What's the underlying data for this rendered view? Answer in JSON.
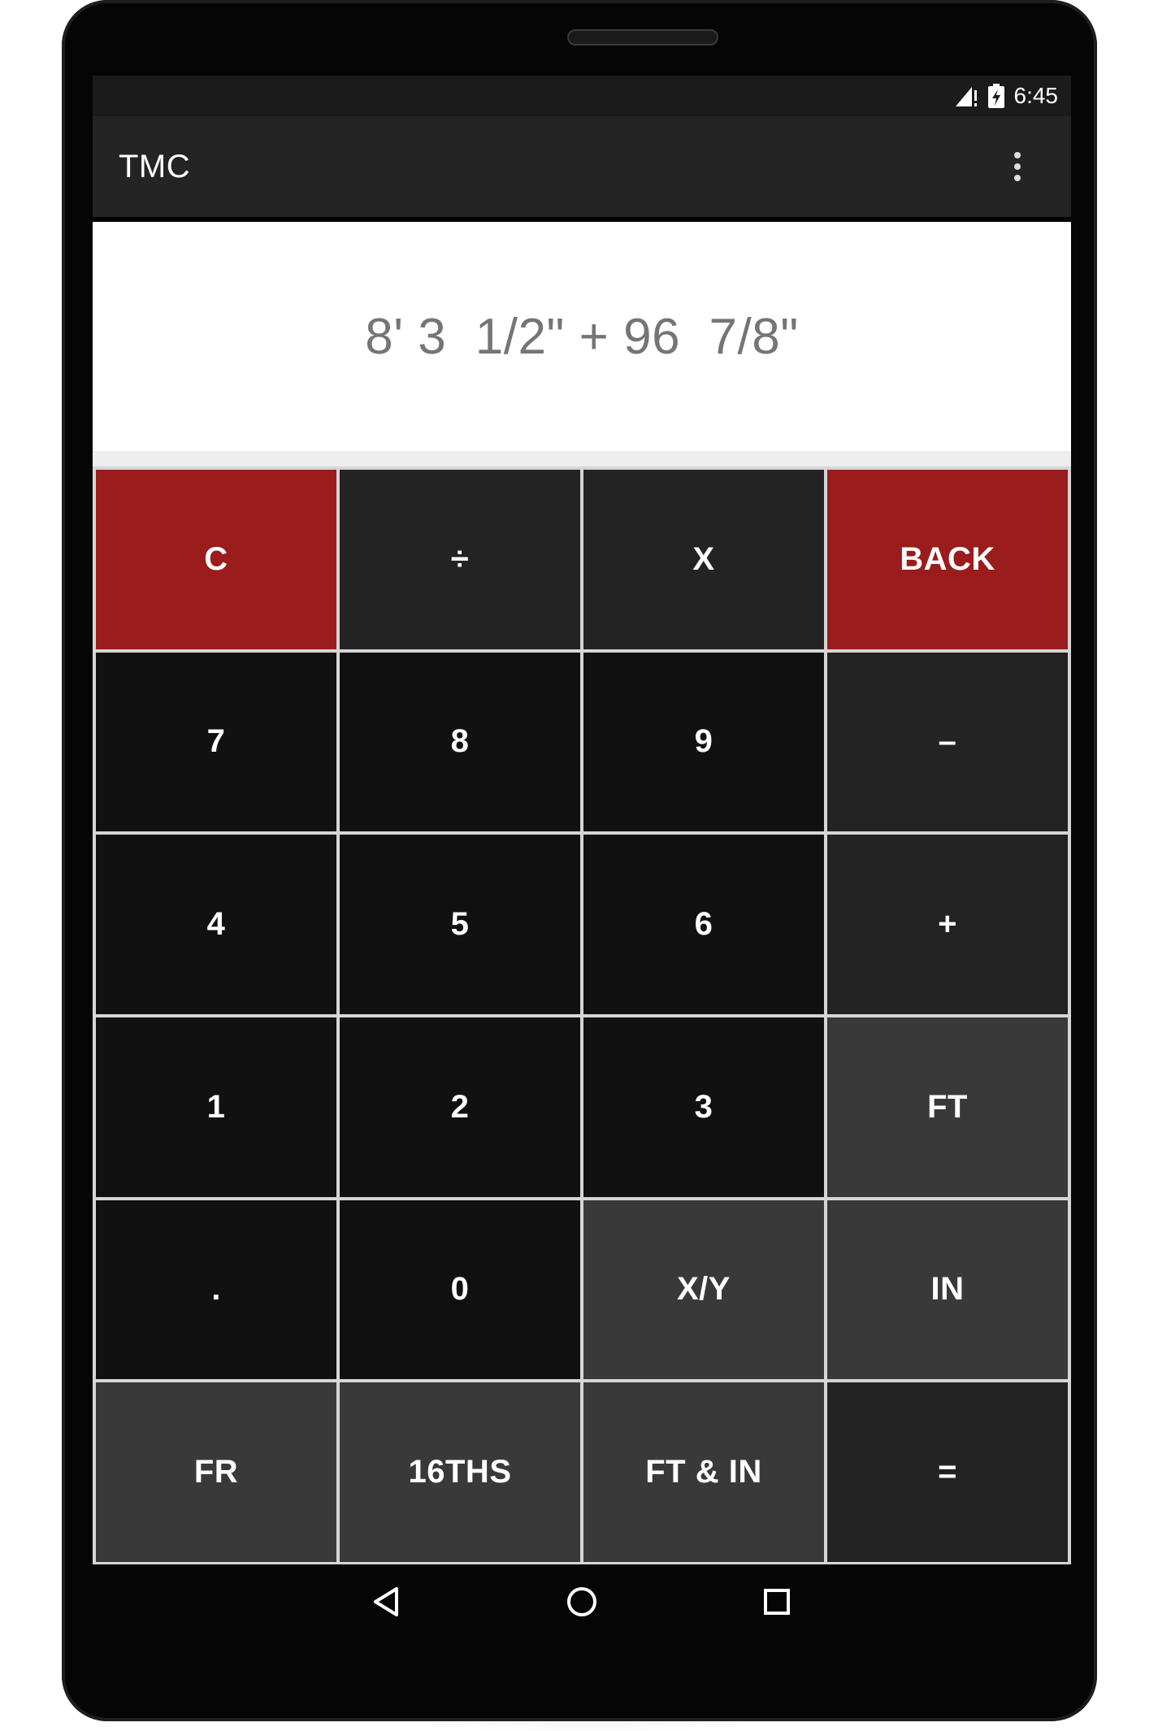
{
  "status_bar": {
    "time": "6:45",
    "signal_icon": "signal-icon",
    "battery_icon": "battery-charging-icon"
  },
  "toolbar": {
    "title": "TMC",
    "overflow_icon": "more-vert-icon"
  },
  "display": {
    "expression": "8' 3  1/2\" + 96  7/8\""
  },
  "keypad": {
    "rows": [
      [
        {
          "label": "C",
          "style": "red"
        },
        {
          "label": "÷",
          "style": "dark"
        },
        {
          "label": "X",
          "style": "dark"
        },
        {
          "label": "BACK",
          "style": "red"
        }
      ],
      [
        {
          "label": "7",
          "style": "black"
        },
        {
          "label": "8",
          "style": "black"
        },
        {
          "label": "9",
          "style": "black"
        },
        {
          "label": "–",
          "style": "dark"
        }
      ],
      [
        {
          "label": "4",
          "style": "black"
        },
        {
          "label": "5",
          "style": "black"
        },
        {
          "label": "6",
          "style": "black"
        },
        {
          "label": "+",
          "style": "dark"
        }
      ],
      [
        {
          "label": "1",
          "style": "black"
        },
        {
          "label": "2",
          "style": "black"
        },
        {
          "label": "3",
          "style": "black"
        },
        {
          "label": "FT",
          "style": "gray"
        }
      ],
      [
        {
          "label": ".",
          "style": "black"
        },
        {
          "label": "0",
          "style": "black"
        },
        {
          "label": "X/Y",
          "style": "gray"
        },
        {
          "label": "IN",
          "style": "gray"
        }
      ],
      [
        {
          "label": "FR",
          "style": "gray"
        },
        {
          "label": "16THS",
          "style": "gray"
        },
        {
          "label": "FT & IN",
          "style": "gray"
        },
        {
          "label": "=",
          "style": "dark"
        }
      ]
    ]
  },
  "navbar": {
    "back_icon": "back-triangle-icon",
    "home_icon": "home-circle-icon",
    "recents_icon": "recents-square-icon"
  },
  "colors": {
    "red": "#9b1c1c",
    "dark": "#232323",
    "black": "#111111",
    "gray": "#393939",
    "toolbar": "#242424",
    "expression_text": "#757575"
  }
}
